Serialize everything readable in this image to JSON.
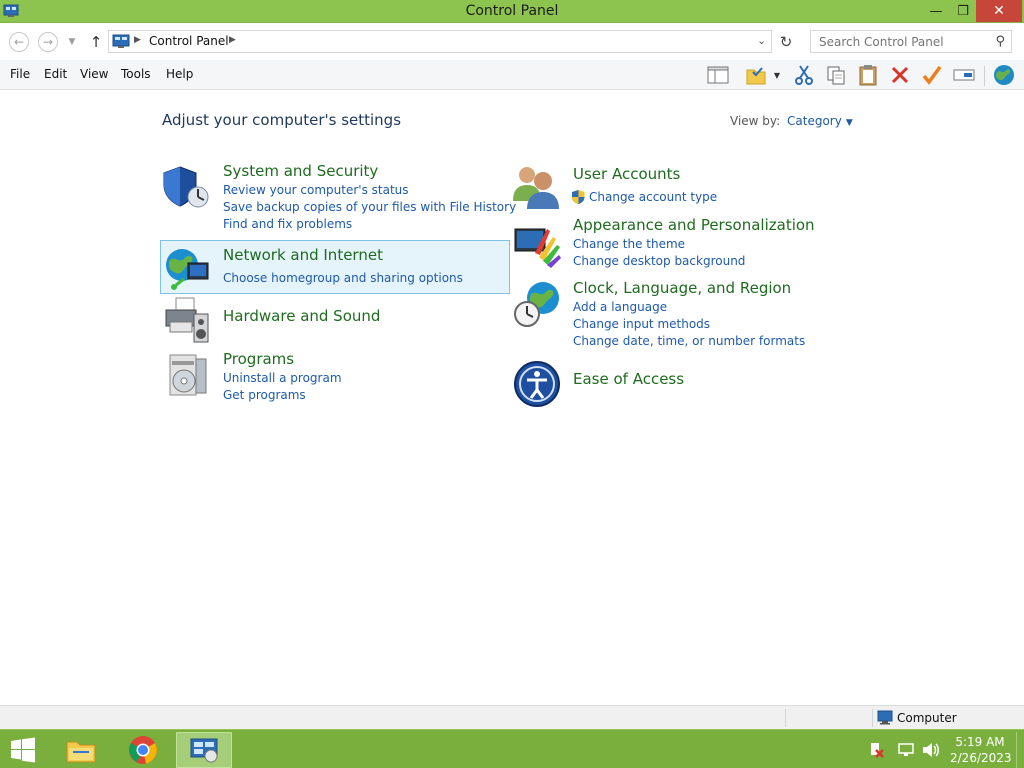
{
  "window": {
    "title": "Control Panel",
    "minimize_glyph": "—",
    "maximize_glyph": "❐",
    "close_glyph": "✕"
  },
  "address": {
    "crumb": "Control Panel",
    "search_placeholder": "Search Control Panel"
  },
  "menu": [
    "File",
    "Edit",
    "View",
    "Tools",
    "Help"
  ],
  "main": {
    "heading": "Adjust your computer's settings",
    "view_by_label": "View by:",
    "view_by_value": "Category"
  },
  "categories": [
    {
      "title": "System and Security",
      "icon": "shield-icon",
      "links": [
        "Review your computer's status",
        "Save backup copies of your files with File History",
        "Find and fix problems"
      ]
    },
    {
      "title": "Network and Internet",
      "icon": "network-globe-icon",
      "links": [
        "Choose homegroup and sharing options"
      ]
    },
    {
      "title": "Hardware and Sound",
      "icon": "printer-icon",
      "links": []
    },
    {
      "title": "Programs",
      "icon": "programs-icon",
      "links": [
        "Uninstall a program",
        "Get programs"
      ]
    },
    {
      "title": "User Accounts",
      "icon": "users-icon",
      "links": [
        "Change account type"
      ]
    },
    {
      "title": "Appearance and Personalization",
      "icon": "monitor-paint-icon",
      "links": [
        "Change the theme",
        "Change desktop background"
      ]
    },
    {
      "title": "Clock, Language, and Region",
      "icon": "clock-globe-icon",
      "links": [
        "Add a language",
        "Change input methods",
        "Change date, time, or number formats"
      ]
    },
    {
      "title": "Ease of Access",
      "icon": "ease-of-access-icon",
      "links": []
    }
  ],
  "statusbar": {
    "location": "Computer"
  },
  "taskbar": {
    "time": "5:19 AM",
    "date": "2/26/2023"
  },
  "colors": {
    "accent_green": "#8dc44f",
    "taskbar_green": "#7aaf3e",
    "category_title": "#1f6b1f",
    "link_blue": "#1e5aa8",
    "heading_blue": "#1e395b"
  }
}
